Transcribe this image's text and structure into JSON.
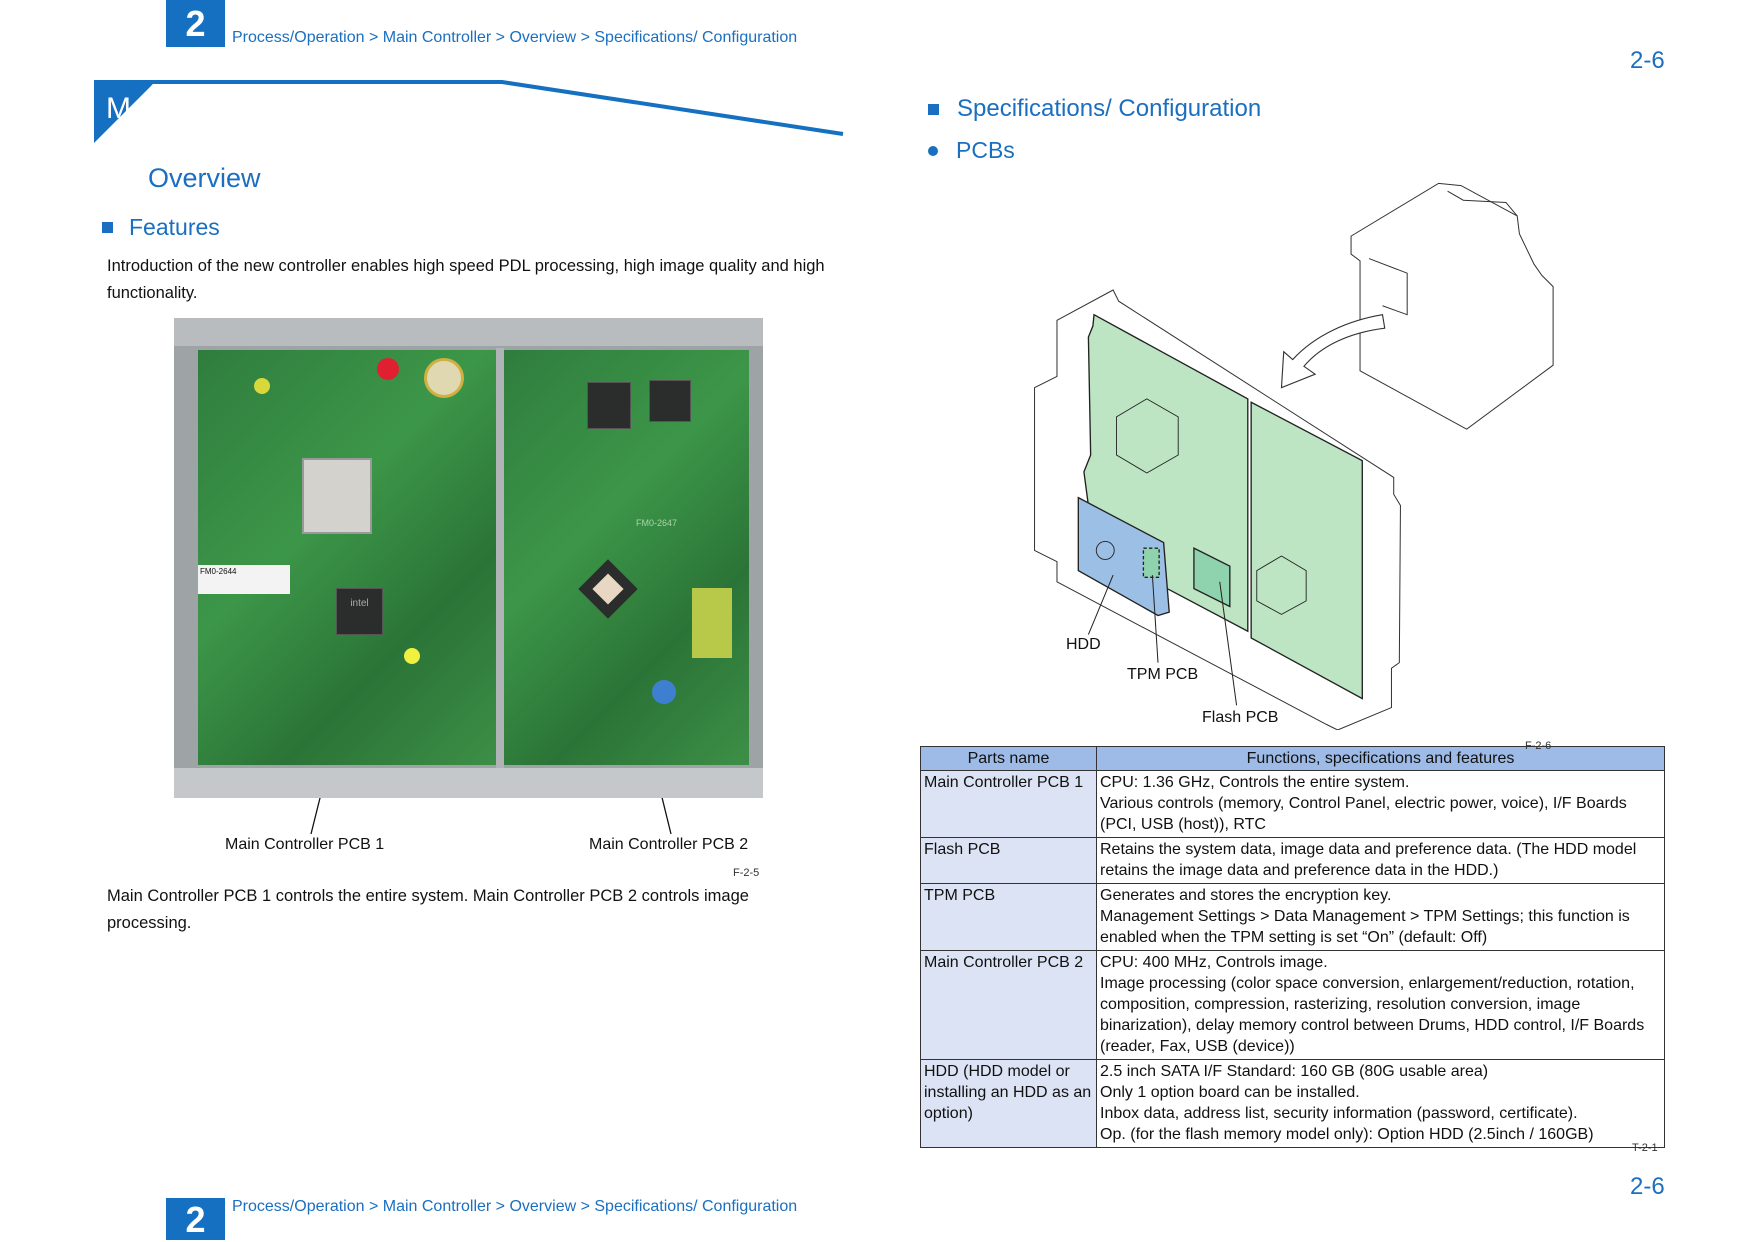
{
  "header": {
    "chapter": "2",
    "breadcrumb": "Process/Operation > Main Controller > Overview > Specifications/ Configuration",
    "page_number": "2-6"
  },
  "left": {
    "section_letter": "M",
    "title": "Overview",
    "features_heading": "Features",
    "intro": "Introduction of the new controller enables high speed PDL processing, high image quality and high functionality.",
    "photo": {
      "label_pcb1": "Main Controller PCB 1",
      "label_pcb2": "Main Controller PCB 2",
      "board_marking_1": "FM0-2644",
      "board_marking_2": "FM0-2647",
      "chip_marking": "intel",
      "figure_id": "F-2-5"
    },
    "description": "Main Controller PCB 1 controls the entire system. Main Controller PCB 2 controls image processing."
  },
  "right": {
    "heading": "Specifications/ Configuration",
    "subheading": "PCBs",
    "diagram": {
      "label_hdd": "HDD",
      "label_tpm": "TPM PCB",
      "label_flash": "Flash PCB",
      "figure_id": "F-2-6"
    },
    "table": {
      "headers": [
        "Parts name",
        "Functions, specifications and features"
      ],
      "rows": [
        {
          "part": "Main Controller PCB 1",
          "lines": [
            "CPU: 1.36 GHz, Controls the entire system.",
            "Various controls (memory, Control Panel, electric power, voice), I/F Boards (PCI, USB (host)), RTC"
          ]
        },
        {
          "part": "Flash PCB",
          "lines": [
            "Retains the system data, image data and preference data. (The HDD model retains the image data and preference data in the HDD.)"
          ]
        },
        {
          "part": "TPM PCB",
          "lines": [
            "Generates and stores the encryption key.",
            "Management Settings > Data Management > TPM Settings; this function is enabled when the TPM setting is set “On” (default: Off)"
          ]
        },
        {
          "part": "Main Controller PCB 2",
          "lines": [
            "CPU: 400 MHz, Controls image.",
            "Image processing (color space conversion, enlargement/reduction, rotation, composition, compression, rasterizing, resolution conversion, image binarization), delay memory control between Drums, HDD control, I/F Boards (reader, Fax, USB (device))"
          ]
        },
        {
          "part": "HDD (HDD model or installing an HDD as an option)",
          "lines": [
            "2.5 inch SATA I/F Standard: 160 GB (80G usable area)",
            "Only 1 option board can be installed.",
            "Inbox data, address list, security information (password, certificate).",
            "Op. (for the flash memory model only): Option HDD (2.5inch / 160GB)"
          ]
        }
      ],
      "table_id": "T-2-1"
    }
  },
  "colors": {
    "brand_blue": "#1570c2",
    "board_green": "#bde5c3",
    "hdd_blue": "#9cbfe6",
    "table_header": "#9dbbe6",
    "table_part_cell": "#dbe3f4"
  }
}
